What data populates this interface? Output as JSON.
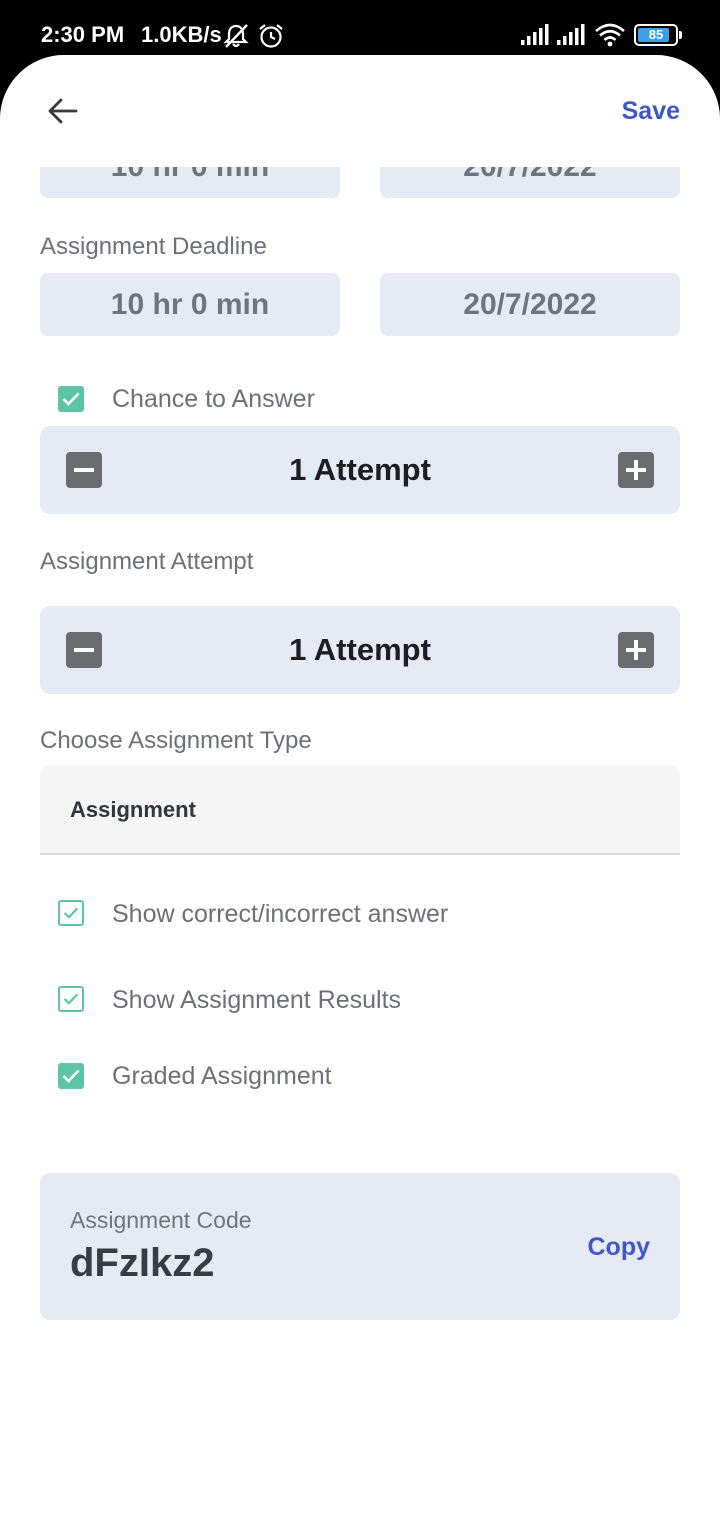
{
  "status_bar": {
    "time": "2:30 PM",
    "speed": "1.0KB/s",
    "battery": "85",
    "battery_level": 0.85,
    "icons": [
      "mute-icon",
      "alarm-icon",
      "signal-icon",
      "signal-icon",
      "wifi-icon",
      "battery-icon"
    ]
  },
  "header": {
    "back_icon": "arrow-left-icon",
    "save_label": "Save"
  },
  "partial_row": {
    "duration": "10 hr 0 min",
    "date": "20/7/2022"
  },
  "deadline": {
    "label": "Assignment Deadline",
    "duration": "10 hr 0 min",
    "date": "20/7/2022"
  },
  "chance": {
    "label": "Chance to Answer",
    "checked": true,
    "value": "1 Attempt"
  },
  "attempt": {
    "label": "Assignment Attempt",
    "value": "1 Attempt"
  },
  "type": {
    "label": "Choose Assignment Type",
    "selected": "Assignment"
  },
  "options": [
    {
      "label": "Show correct/incorrect answer",
      "checked": true
    },
    {
      "label": "Show Assignment Results",
      "checked": true
    },
    {
      "label": "Graded Assignment",
      "checked": true
    }
  ],
  "code": {
    "label": "Assignment Code",
    "value": "dFzIkz2",
    "copy_label": "Copy"
  },
  "colors": {
    "accent": "#3f57c9",
    "check": "#5ec4a6",
    "field_bg": "#e6eaf4"
  }
}
